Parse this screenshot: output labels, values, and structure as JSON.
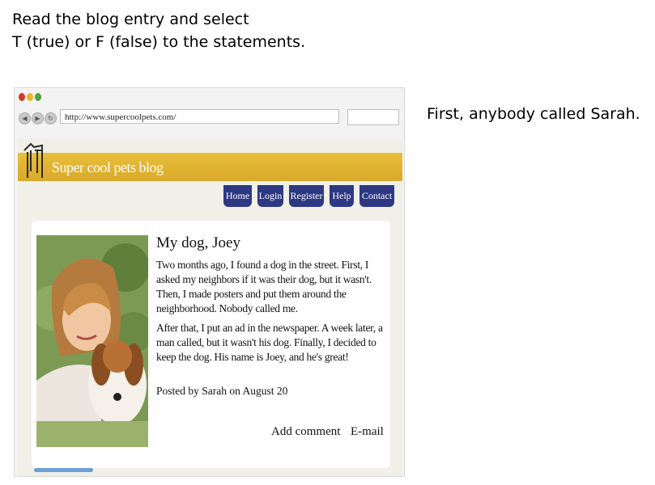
{
  "instructions": {
    "line1": "Read the blog entry and select",
    "line2": "T (true) or F (false) to the statements."
  },
  "statement": "First, anybody called Sarah.",
  "browser": {
    "url": "http://www.supercoolpets.com/"
  },
  "blog": {
    "name": "Super cool pets blog",
    "nav": [
      "Home",
      "Login",
      "Register",
      "Help",
      "Contact"
    ],
    "post": {
      "title": "My dog, Joey",
      "paragraph1": "Two months ago, I found a dog in the street. First, I asked my neighbors if it was their dog, but it wasn't. Then, I made posters and put them around the neighborhood. Nobody called me.",
      "paragraph2": "After that, I put an ad in the newspaper. A week later, a man called, but it wasn't his dog. Finally, I decided to keep the dog. His name is Joey, and he's great!",
      "posted_by": "Posted by Sarah on August 20",
      "add_comment": "Add comment",
      "email": "E-mail"
    }
  },
  "colors": {
    "banner": "#dcae2e",
    "nav_tab": "#2e3882"
  }
}
